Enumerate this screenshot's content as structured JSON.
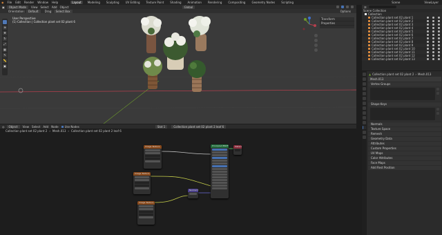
{
  "menu": {
    "items": [
      "File",
      "Edit",
      "Render",
      "Window",
      "Help"
    ],
    "workspaces": [
      "Layout",
      "Modeling",
      "Sculpting",
      "UV Editing",
      "Texture Paint",
      "Shading",
      "Animation",
      "Rendering",
      "Compositing",
      "Geometry Nodes",
      "Scripting"
    ],
    "active_workspace": "Layout",
    "scene_label": "Scene",
    "view_layer_label": "ViewLayer"
  },
  "viewport": {
    "mode": "Object Mode",
    "menus": [
      "View",
      "Select",
      "Add",
      "Object"
    ],
    "transform": "Global",
    "orientation_label": "Orientation:",
    "orientation_value": "Default",
    "drag_label": "Drag:",
    "drag_value": "Select Box",
    "options_label": "Options",
    "info_line1": "User Perspective",
    "info_line2": "(1) Collection | Collection plant set 02 plant 6",
    "npanel_items": [
      "Transform",
      "Properties"
    ],
    "tools": [
      "select",
      "cursor",
      "move",
      "rotate",
      "scale",
      "transform",
      "annotate",
      "measure",
      "add-cube"
    ]
  },
  "node_editor": {
    "mode": "Object",
    "menus": [
      "View",
      "Select",
      "Add",
      "Node"
    ],
    "use_nodes_label": "Use Nodes",
    "slot": "Slot 1",
    "material": "Collection plant set 02 plant 2 leaf 6",
    "breadcrumb": [
      "Collection plant set 02 plant 2",
      "Mesh.013",
      "Collection plant set 02 plant 2 leaf 6"
    ],
    "nodes": [
      {
        "title": "Image Texture",
        "color": "#8a4a1c"
      },
      {
        "title": "Image Texture",
        "color": "#8a4a1c"
      },
      {
        "title": "Image Texture",
        "color": "#8a4a1c"
      },
      {
        "title": "Normal Map",
        "color": "#4a3f8a"
      },
      {
        "title": "Principled BSDF",
        "color": "#1f6b3a"
      },
      {
        "title": "Material Output",
        "color": "#8a2b3a"
      }
    ]
  },
  "outliner": {
    "title": "Scene Collection",
    "collection": "Collection",
    "rows": [
      "Collection plant set 02 plant 1",
      "Collection plant set 02 plant 2",
      "Collection plant set 02 plant 3",
      "Collection plant set 02 plant 4",
      "Collection plant set 02 plant 5",
      "Collection plant set 02 plant 6",
      "Collection plant set 02 plant 7",
      "Collection plant set 02 plant 8",
      "Collection plant set 02 plant 9",
      "Collection plant set 02 plant 10",
      "Collection plant set 02 plant 11",
      "Collection plant set 02 plant 12",
      "Collection plant set 02 plant 13"
    ]
  },
  "properties": {
    "breadcrumb_object": "Collection plant set 02 plant 2",
    "breadcrumb_data": "Mesh.013",
    "data_name": "Mesh.013",
    "panels_open": [
      "Vertex Groups",
      "Shape Keys"
    ],
    "panels_closed": [
      "Normals",
      "Texture Space",
      "Remesh",
      "Geometry Data",
      "Attributes",
      "Custom Properties",
      "UV Maps",
      "Color Attributes",
      "Face Maps",
      "Add Rest Position"
    ]
  },
  "colors": {
    "accent": "#4772b3",
    "viewport_bg": "#3a3a3a",
    "editor_bg": "#1d1d1d",
    "x_axis": "#b53f4d",
    "y_axis": "#6d9a2c",
    "z_axis": "#3d71d1"
  }
}
